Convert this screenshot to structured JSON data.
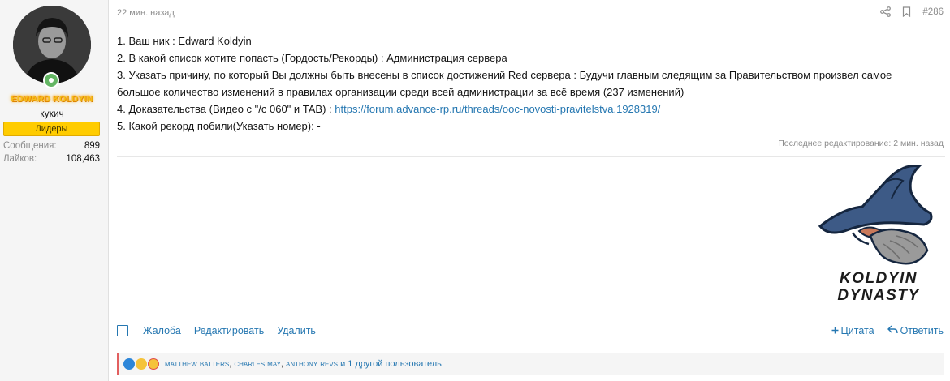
{
  "user": {
    "name": "EDWARD KOLDYIN",
    "title": "кукич",
    "banner": "Лидеры",
    "stats": [
      {
        "label": "Сообщения:",
        "value": "899"
      },
      {
        "label": "Лайков:",
        "value": "108,463"
      }
    ]
  },
  "post": {
    "time": "22 мин. назад",
    "number": "#286",
    "lines": [
      "1. Ваш ник : Edward Koldyin",
      "2. В какой список хотите попасть (Гордость/Рекорды) : Администрация сервера",
      "3. Указать причину, по который Вы должны быть внесены в список достижений Red сервера : Будучи главным следящим за Правительством произвел самое",
      "большое количество изменений в правилах организации среди всей администрации за всё время (237 изменений)"
    ],
    "line4_prefix": "4. Доказательства (Видео с \"/c 060\" и TAB) : ",
    "line4_link": "https://forum.advance-rp.ru/threads/ooc-novosti-pravitelstva.1928319/",
    "line5": "5. Какой рекорд побили(Указать номер): -",
    "last_edit": "Последнее редактирование: 2 мин. назад"
  },
  "signature": {
    "line1": "KOLDYIN",
    "line2": "DYNASTY"
  },
  "actions": {
    "report": "Жалоба",
    "edit": "Редактировать",
    "delete": "Удалить",
    "quote": "Цитата",
    "reply": "Ответить"
  },
  "reactions": {
    "user1": "Matthew Batters",
    "user2": "Charles May",
    "user3": "Anthony Revs",
    "sep": ",",
    "and_more": "и 1 другой пользователь"
  },
  "colors": {
    "link": "#2577b1",
    "banner": "#ffcc00",
    "username_glow": "#f2c01c",
    "reaction_bar_accent": "#e25f5f"
  }
}
